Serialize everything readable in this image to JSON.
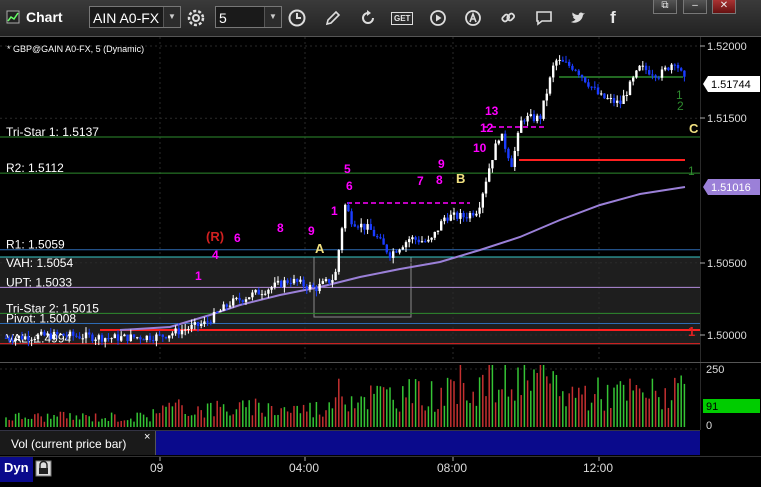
{
  "toolbar": {
    "title": "Chart",
    "symbol": "AIN A0-FX",
    "period": "5",
    "win_controls": [
      "⧉",
      "–",
      "✕"
    ],
    "icons": [
      "pencil-icon",
      "refresh-icon",
      "get-icon",
      "play-icon",
      "alert-icon",
      "link-icon",
      "message-icon",
      "twitter-icon",
      "facebook-icon"
    ]
  },
  "chart": {
    "header": "* GBP@GAIN A0-FX, 5 (Dynamic)",
    "current_price": "1.51744",
    "ma_price": "1.51016",
    "y_ticks": [
      "1.52000",
      "1.51500",
      "1.50500",
      "1.50000"
    ],
    "x_labels": [
      "09",
      "04:00",
      "08:00",
      "12:00"
    ],
    "levels": [
      {
        "label": "Tri-Star 1: 1.5137",
        "value": 1.5137,
        "color": "#2e8b2e"
      },
      {
        "label": "R2: 1.5112",
        "value": 1.5112,
        "color": "#2e8b2e"
      },
      {
        "label": "R1: 1.5059",
        "value": 1.5059,
        "color": "#2d6bb3"
      },
      {
        "label": "VAH: 1.5054",
        "value": 1.5054,
        "color": "#37c8c8"
      },
      {
        "label": "UPT: 1.5033",
        "value": 1.5033,
        "color": "#b48cdc"
      },
      {
        "label": "Tri-Star 2: 1.5015",
        "value": 1.5015,
        "color": "#2e8b2e"
      },
      {
        "label": "Pivot: 1.5008",
        "value": 1.5008,
        "color": "#2d6bb3"
      },
      {
        "label": "VAL: 1.4994",
        "value": 1.4994,
        "color": "#e02020"
      }
    ],
    "labels": {
      "A": "A",
      "B": "B",
      "C": "C",
      "R": "(R)",
      "counts": [
        "1",
        "4",
        "6",
        "8",
        "9",
        "1",
        "5",
        "6",
        "7",
        "8",
        "9",
        "12",
        "13",
        "10"
      ],
      "right_counts": [
        "1",
        "2",
        "1",
        "1"
      ]
    }
  },
  "indicator": {
    "name": "Vol (current price bar)",
    "close_label": "×",
    "ticks": [
      "250",
      "0"
    ],
    "current": "91"
  },
  "footer": {
    "dyn": "Dyn"
  },
  "colors": {
    "up_candle": "#ffffff",
    "down_candle": "#1a3cff",
    "ma": "#9b80d8",
    "magenta": "#ff00ff",
    "vol_up": "#35c535",
    "vol_down": "#c53030",
    "current_green": "#00cc00"
  }
}
